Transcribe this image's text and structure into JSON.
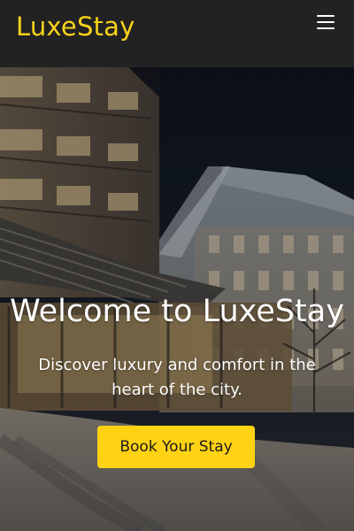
{
  "brand": {
    "name": "LuxeStay",
    "color": "#f7d21b"
  },
  "navbar": {
    "menu_icon": "hamburger-menu-icon"
  },
  "hero": {
    "title": "Welcome to LuxeStay",
    "subtitle": "Discover luxury and comfort in the heart of the city.",
    "cta_label": "Book Your Stay",
    "cta_color": "#ffd214",
    "background_image": "snowy hotel exterior at night"
  }
}
